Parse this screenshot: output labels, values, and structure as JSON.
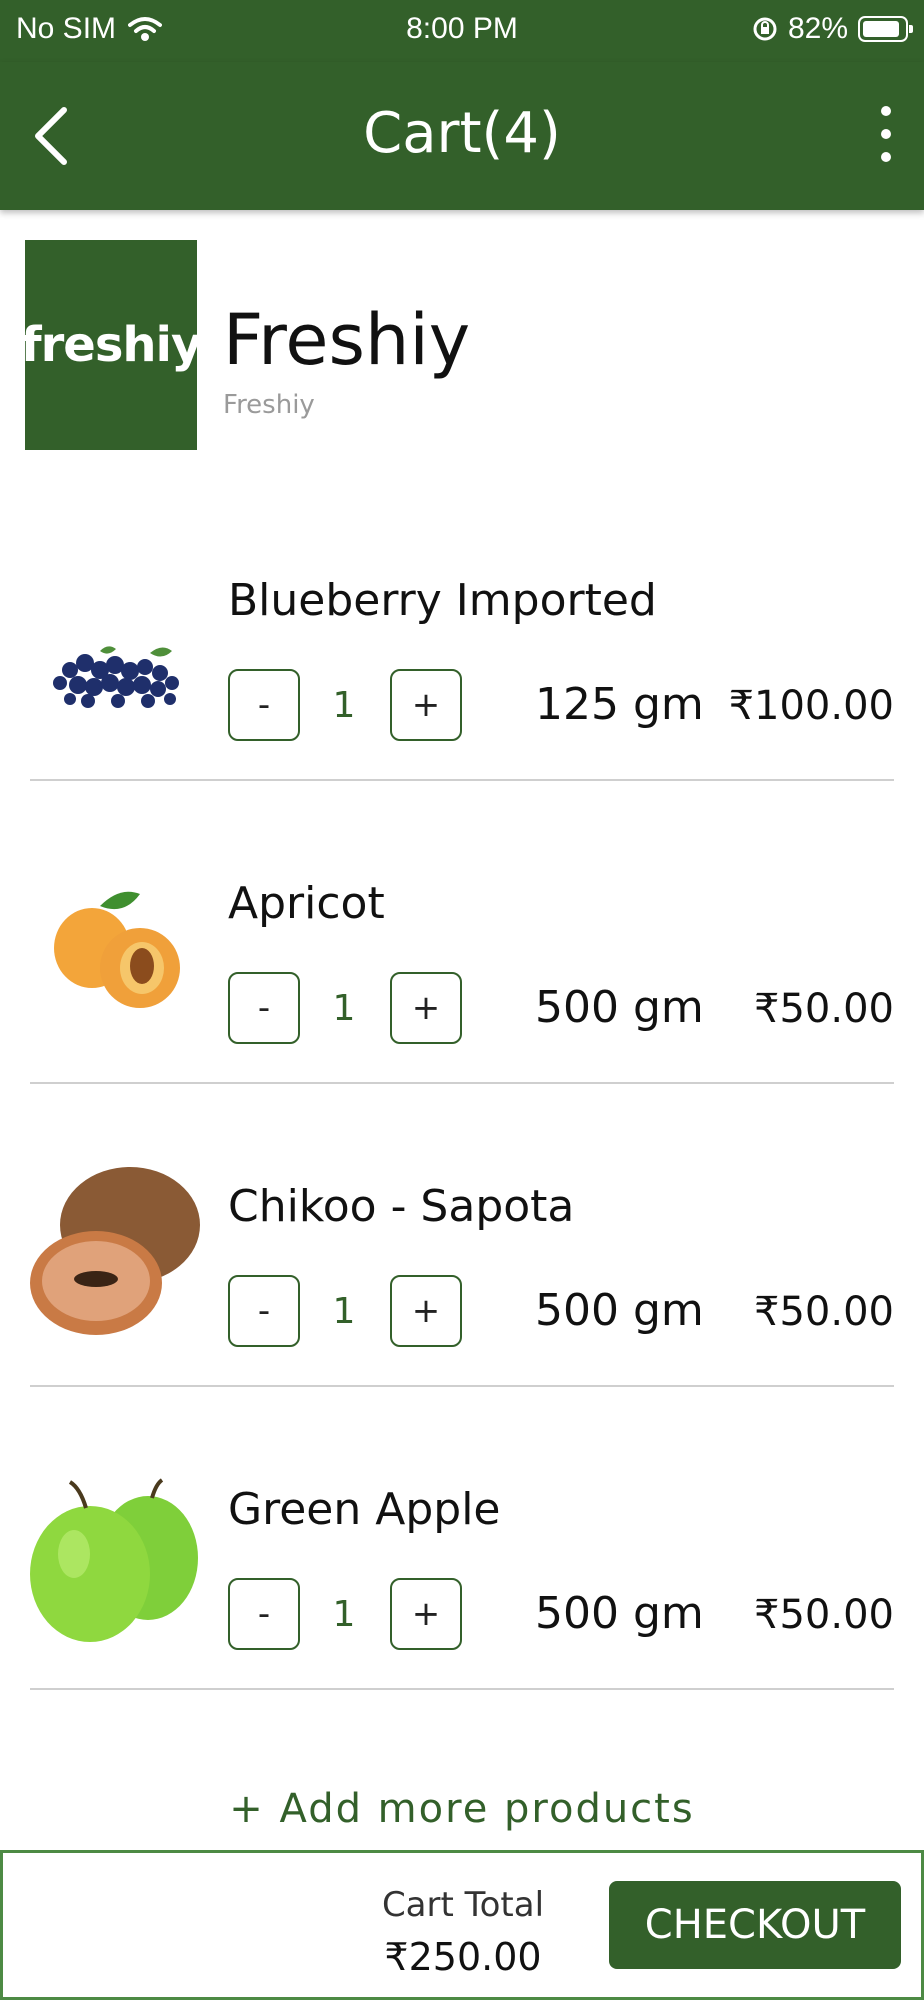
{
  "status_bar": {
    "carrier": "No SIM",
    "time": "8:00 PM",
    "battery": "82%"
  },
  "header": {
    "title": "Cart(4)"
  },
  "store": {
    "logo_text": "freshiy",
    "name": "Freshiy",
    "subtitle": "Freshiy"
  },
  "items": [
    {
      "name": "Blueberry Imported",
      "quantity": "1",
      "weight": "125 gm",
      "price": "₹100.00",
      "minus": "-",
      "plus": "+"
    },
    {
      "name": "Apricot",
      "quantity": "1",
      "weight": "500 gm",
      "price": "₹50.00",
      "minus": "-",
      "plus": "+"
    },
    {
      "name": "Chikoo - Sapota",
      "quantity": "1",
      "weight": "500 gm",
      "price": "₹50.00",
      "minus": "-",
      "plus": "+"
    },
    {
      "name": "Green Apple",
      "quantity": "1",
      "weight": "500 gm",
      "price": "₹50.00",
      "minus": "-",
      "plus": "+"
    }
  ],
  "add_more_label": "+ Add more products",
  "footer": {
    "total_label": "Cart Total",
    "total_value": "₹250.00",
    "checkout_label": "CHECKOUT"
  },
  "colors": {
    "brand_green": "#33602a",
    "divider": "#cfcfcf"
  }
}
